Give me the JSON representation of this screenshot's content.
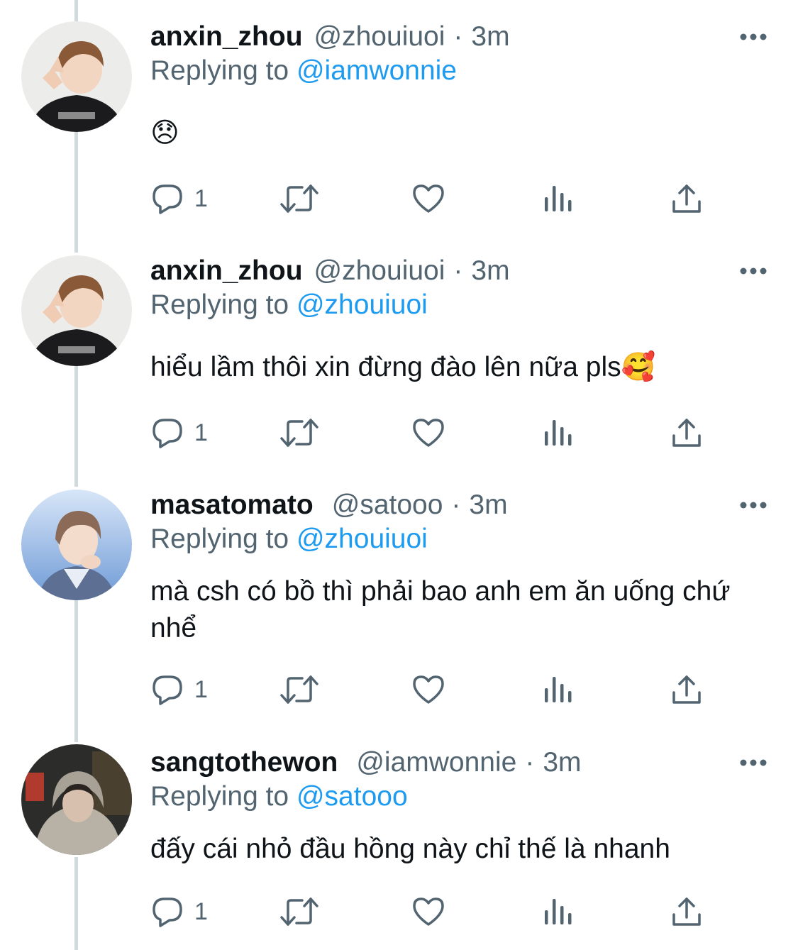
{
  "tweets": [
    {
      "display_name": "anxin_zhou",
      "handle": "@zhouiuoi",
      "dot": "·",
      "time": "3m",
      "replying_prefix": "Replying to",
      "replying_to": "@iamwonnie",
      "text": "😞",
      "reply_count": "1",
      "avatar_icon": "avatar-photo-icon"
    },
    {
      "display_name": "anxin_zhou",
      "handle": "@zhouiuoi",
      "dot": "·",
      "time": "3m",
      "replying_prefix": "Replying to",
      "replying_to": "@zhouiuoi",
      "text": "hiểu lầm thôi xin đừng đào lên nữa pls🥰",
      "reply_count": "1",
      "avatar_icon": "avatar-photo-icon"
    },
    {
      "display_name": "masatomato",
      "handle": "@satooo",
      "dot": "·",
      "time": "3m",
      "replying_prefix": "Replying to",
      "replying_to": "@zhouiuoi",
      "text": "mà csh có bồ thì phải bao anh em ăn uống chứ nhể",
      "reply_count": "1",
      "avatar_icon": "avatar-photo-icon"
    },
    {
      "display_name": "sangtothewon",
      "handle": "@iamwonnie",
      "dot": "·",
      "time": "3m",
      "replying_prefix": "Replying to",
      "replying_to": "@satooo",
      "text": "đấy cái nhỏ đầu hồng này chỉ thế là nhanh",
      "reply_count": "1",
      "avatar_icon": "avatar-photo-icon"
    }
  ],
  "icons": {
    "reply": "reply-icon",
    "retweet": "retweet-icon",
    "like": "heart-icon",
    "views": "views-icon",
    "share": "share-icon",
    "more": "more-icon"
  },
  "colors": {
    "text": "#0f1419",
    "secondary": "#536471",
    "link": "#1d9bf0",
    "thread_line": "#cfd9de"
  }
}
